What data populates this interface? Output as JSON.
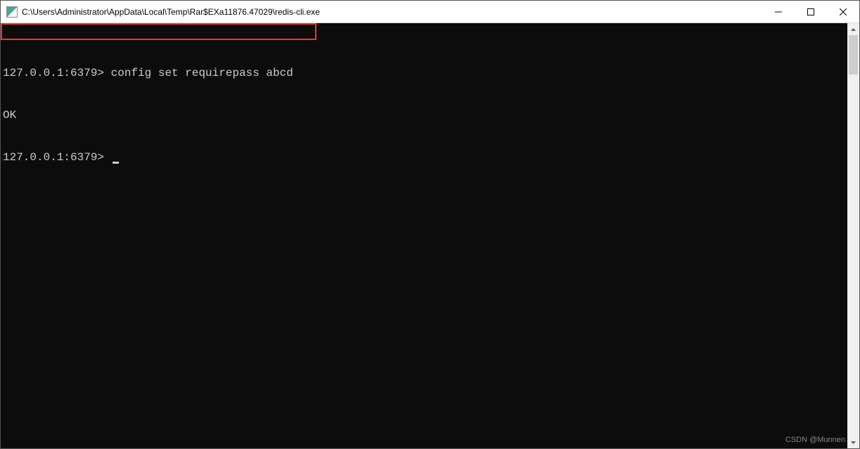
{
  "window": {
    "title": "C:\\Users\\Administrator\\AppData\\Local\\Temp\\Rar$EXa11876.47029\\redis-cli.exe"
  },
  "terminal": {
    "lines": [
      {
        "prompt": "127.0.0.1:6379>",
        "command": " config set requirepass abcd"
      },
      {
        "output": "OK"
      },
      {
        "prompt": "127.0.0.1:6379>",
        "command": " ",
        "cursor": true
      }
    ]
  },
  "watermark": "CSDN @Munnen"
}
